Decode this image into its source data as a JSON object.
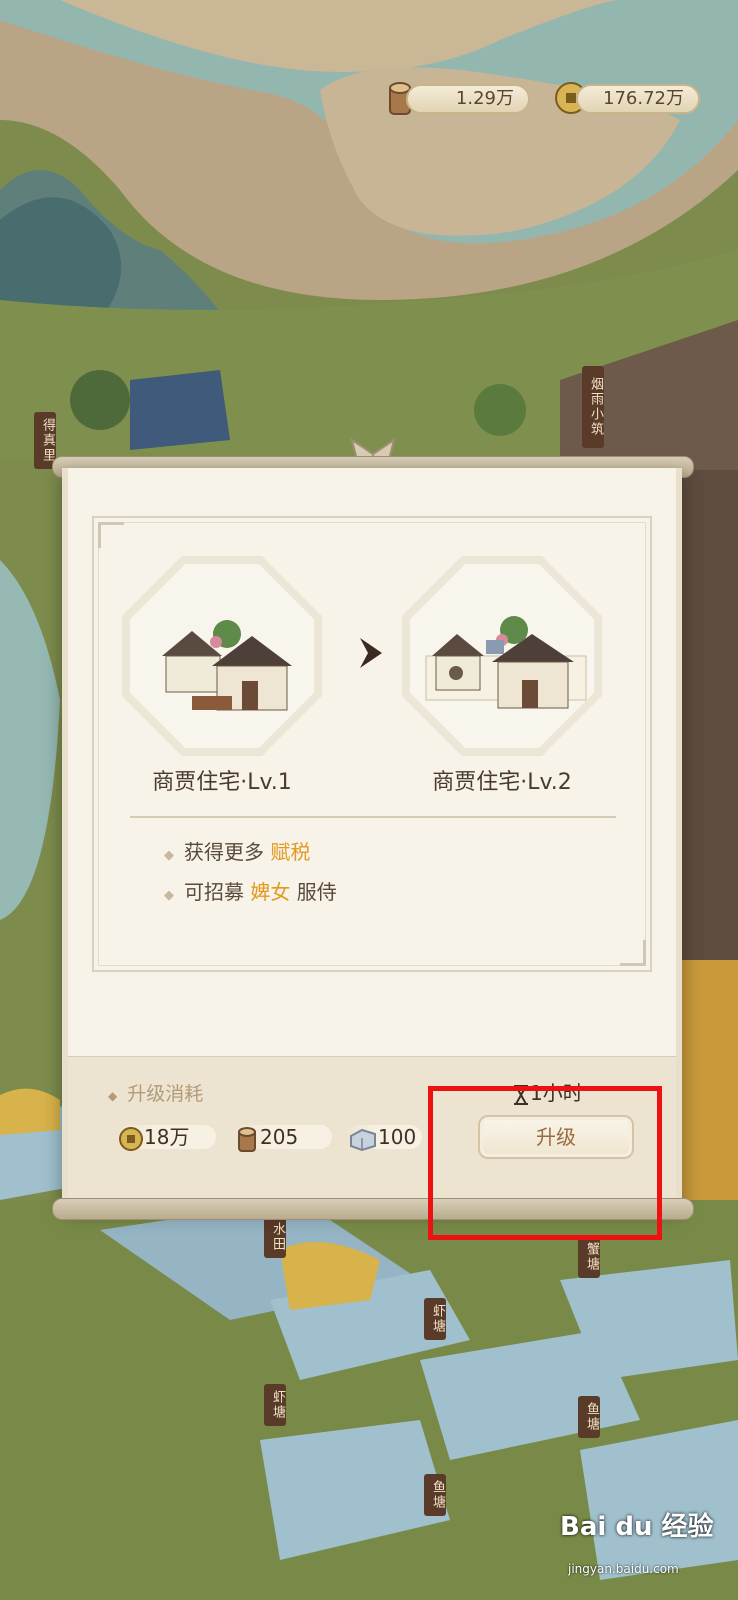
{
  "resources": {
    "wood": "1.29万",
    "copper": "176.72万"
  },
  "map_signs": [
    "得真里",
    "烟雨小筑",
    "水田",
    "虾塘",
    "蟹塘",
    "虾塘",
    "鱼塘",
    "鱼塘"
  ],
  "dialog": {
    "current": {
      "name": "商贾住宅·Lv.1"
    },
    "next": {
      "name": "商贾住宅·Lv.2"
    },
    "benefits": [
      {
        "prefix": "获得更多 ",
        "highlight": "赋税",
        "suffix": ""
      },
      {
        "prefix": "可招募 ",
        "highlight": "婢女",
        "suffix": " 服侍"
      }
    ],
    "cost_title": "升级消耗",
    "costs": {
      "copper": "18万",
      "wood": "205",
      "stone": "100"
    },
    "duration": "1小时",
    "upgrade_label": "升级"
  },
  "watermark": {
    "brand": "Bai du 经验",
    "url": "jingyan.baidu.com"
  },
  "colors": {
    "highlight": "#e39a22",
    "annotation": "#ee1111"
  }
}
